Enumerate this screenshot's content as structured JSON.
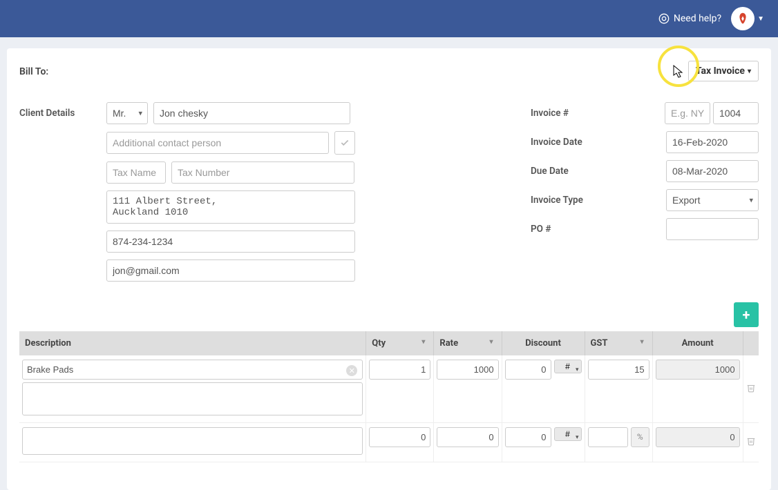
{
  "header": {
    "help_label": "Need help?"
  },
  "billto_label": "Bill To:",
  "client_details_label": "Client Details",
  "invoice_type_toggle": "Tax Invoice",
  "client": {
    "salutation": "Mr.",
    "name": "Jon chesky",
    "additional_contact_placeholder": "Additional contact person",
    "tax_name_placeholder": "Tax Name",
    "tax_number_placeholder": "Tax Number",
    "address": "111 Albert Street,\nAuckland 1010",
    "phone": "874-234-1234",
    "email": "jon@gmail.com"
  },
  "invoice_meta": {
    "number_label": "Invoice #",
    "number_prefix_placeholder": "E.g. NYC",
    "number_value": "1004",
    "date_label": "Invoice Date",
    "date_value": "16-Feb-2020",
    "due_label": "Due Date",
    "due_value": "08-Mar-2020",
    "type_label": "Invoice Type",
    "type_value": "Export",
    "po_label": "PO #",
    "po_value": ""
  },
  "line_headers": {
    "desc": "Description",
    "qty": "Qty",
    "rate": "Rate",
    "discount": "Discount",
    "gst": "GST",
    "amount": "Amount"
  },
  "lines": [
    {
      "desc": "Brake Pads",
      "notes": "",
      "qty": "1",
      "rate": "1000",
      "discount": "0",
      "discount_type": "#",
      "gst": "15",
      "gst_suffix": "",
      "amount": "1000"
    },
    {
      "desc": "",
      "notes": "",
      "qty": "0",
      "rate": "0",
      "discount": "0",
      "discount_type": "#",
      "gst": "",
      "gst_suffix": "%",
      "amount": "0"
    }
  ]
}
